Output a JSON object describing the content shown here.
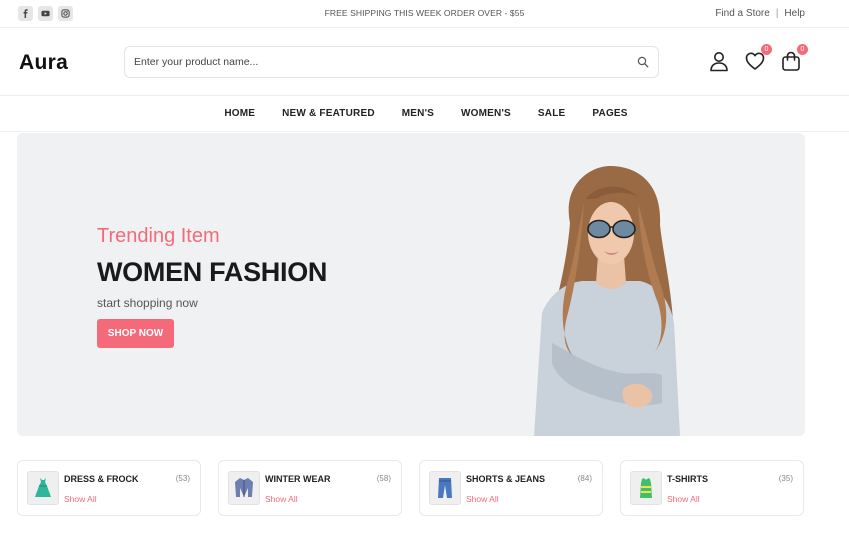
{
  "topbar": {
    "social": [
      "facebook-icon",
      "youtube-icon",
      "instagram-icon"
    ],
    "shipping_text": "FREE SHIPPING THIS WEEK ORDER OVER - $55",
    "find_store": "Find a Store",
    "separator": "|",
    "help": "Help"
  },
  "header": {
    "logo": "Aura",
    "search_placeholder": "Enter your product name...",
    "wishlist_count": "0",
    "cart_count": "0"
  },
  "nav": {
    "items": [
      "HOME",
      "NEW & FEATURED",
      "MEN'S",
      "WOMEN'S",
      "SALE",
      "PAGES"
    ]
  },
  "hero": {
    "subtitle": "Trending Item",
    "title": "WOMEN FASHION",
    "description": "start shopping now",
    "button": "SHOP NOW"
  },
  "categories": [
    {
      "name": "DRESS & FROCK",
      "count": "(53)",
      "link": "Show All",
      "icon": "dress-icon"
    },
    {
      "name": "WINTER WEAR",
      "count": "(58)",
      "link": "Show All",
      "icon": "jacket-icon"
    },
    {
      "name": "SHORTS & JEANS",
      "count": "(84)",
      "link": "Show All",
      "icon": "jeans-icon"
    },
    {
      "name": "T-SHIRTS",
      "count": "(35)",
      "link": "Show All",
      "icon": "tshirt-icon"
    }
  ],
  "colors": {
    "accent": "#f56a79",
    "hero_bg": "#f0f1f3",
    "text_dark": "#1a1a1a"
  }
}
